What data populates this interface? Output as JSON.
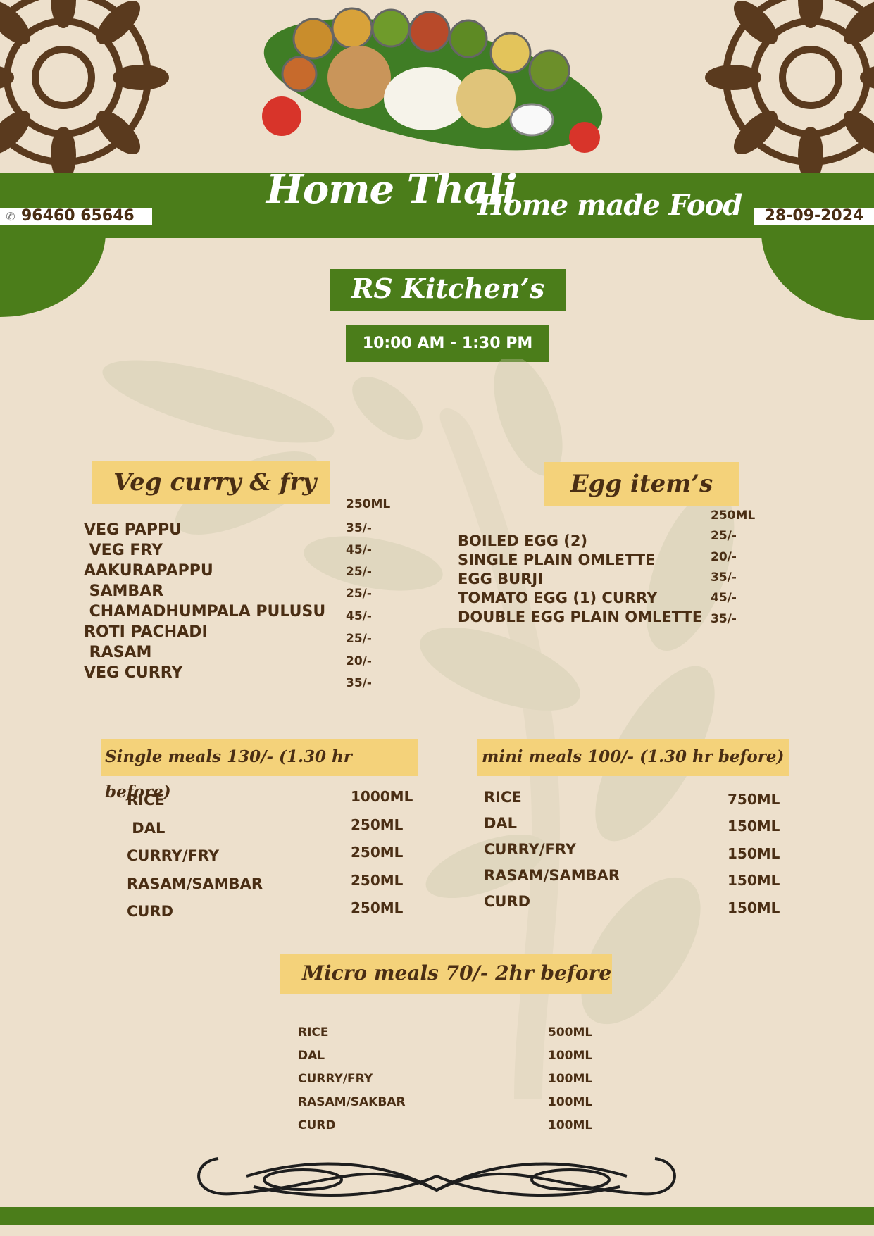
{
  "header": {
    "brand": "Home Thali",
    "tagline": "Home made Food",
    "phone": "96460 65646",
    "date": "28-09-2024",
    "phone_icon": "phone-icon"
  },
  "kitchen": {
    "name": "RS Kitchen’s",
    "hours": "10:00 AM - 1:30 PM"
  },
  "veg": {
    "title": "Veg curry & fry",
    "size_label": "250ML",
    "items": [
      "VEG PAPPU",
      " VEG FRY",
      "AAKURAPAPPU",
      " SAMBAR",
      " CHAMADHUMPALA PULUSU",
      "ROTI PACHADI",
      " RASAM",
      "VEG CURRY"
    ],
    "prices": [
      "35/-",
      "45/-",
      "25/-",
      "25/-",
      "45/-",
      "25/-",
      "20/-",
      "35/-"
    ]
  },
  "egg": {
    "title": "Egg item’s",
    "size_label": "250ML",
    "items": [
      "BOILED EGG (2)",
      "SINGLE PLAIN OMLETTE",
      "EGG BURJI",
      "TOMATO EGG (1) CURRY",
      "DOUBLE EGG PLAIN OMLETTE"
    ],
    "prices": [
      "25/-",
      "20/-",
      "35/-",
      "45/-",
      "35/-"
    ]
  },
  "single_meals": {
    "title": "Single meals 130/- (1.30 hr before)",
    "items": [
      "RICE",
      " DAL",
      "CURRY/FRY",
      "RASAM/SAMBAR",
      "CURD"
    ],
    "qty": [
      "1000ML",
      "250ML",
      "250ML",
      "250ML",
      "250ML"
    ]
  },
  "mini_meals": {
    "title": "mini meals 100/- (1.30 hr before)",
    "items": [
      "RICE",
      "DAL",
      "CURRY/FRY",
      "RASAM/SAMBAR",
      "CURD"
    ],
    "qty": [
      "750ML",
      "150ML",
      "150ML",
      "150ML",
      "150ML"
    ]
  },
  "micro_meals": {
    "title": "Micro meals 70/- 2hr before",
    "items": [
      "RICE",
      "DAL",
      "CURRY/FRY",
      "RASAM/SAKBAR",
      "CURD"
    ],
    "qty": [
      "500ML",
      "100ML",
      "100ML",
      "100ML",
      "100ML"
    ]
  },
  "colors": {
    "background": "#ede0cc",
    "green": "#4b7d1a",
    "section_yellow": "#f4d27a",
    "text_brown": "#4a2e14"
  }
}
